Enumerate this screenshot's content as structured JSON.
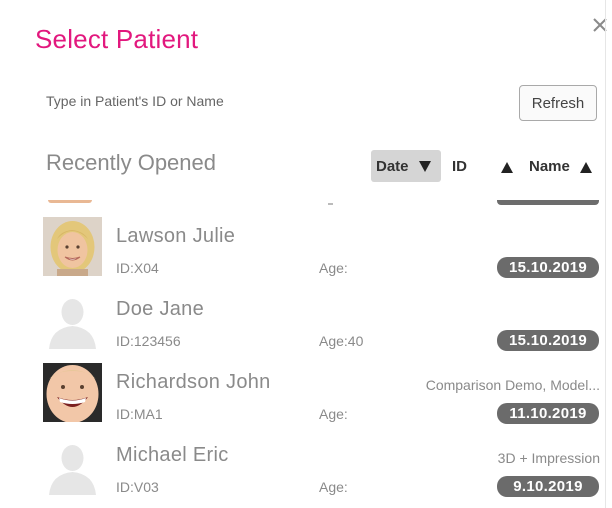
{
  "dialog": {
    "title": "Select Patient",
    "close_icon": "close-icon",
    "search_label": "Type in Patient's ID or Name",
    "refresh_label": "Refresh",
    "recent_label": "Recently Opened",
    "sort": {
      "date_label": "Date",
      "id_label": "ID",
      "name_label": "Name"
    }
  },
  "patients": [
    {
      "name": "Lawson Julie",
      "id": "ID:X04",
      "age": "Age:",
      "note": "",
      "date": "15.10.2019",
      "avatar": "photo-avatar"
    },
    {
      "name": "Doe Jane",
      "id": "ID:123456",
      "age": "Age:40",
      "note": "",
      "date": "15.10.2019",
      "avatar": "placeholder-avatar"
    },
    {
      "name": "Richardson John",
      "id": "ID:MA1",
      "age": "Age:",
      "note": "Comparison Demo, Model...",
      "date": "11.10.2019",
      "avatar": "photo-avatar"
    },
    {
      "name": "Michael Eric",
      "id": "ID:V03",
      "age": "Age:",
      "note": "3D + Impression",
      "date": "9.10.2019",
      "avatar": "placeholder-avatar"
    }
  ],
  "colors": {
    "accent": "#e2187e",
    "date_badge": "#6b6b6b",
    "sort_active_bg": "#d5d5d5"
  }
}
